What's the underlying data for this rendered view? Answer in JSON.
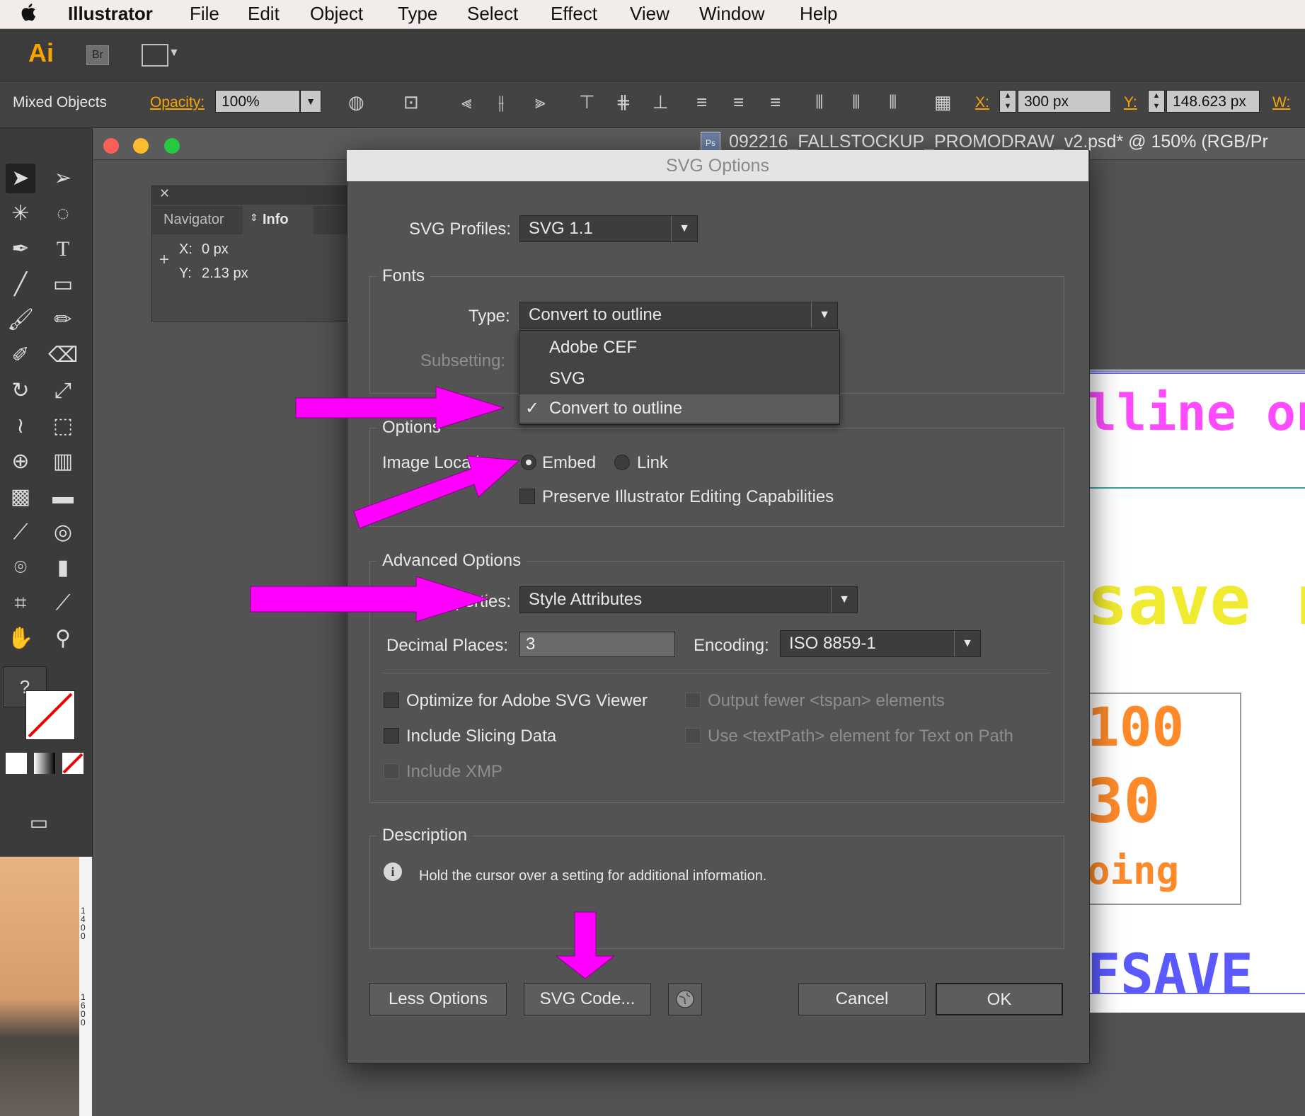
{
  "menubar": {
    "apple": "",
    "items": [
      "Illustrator",
      "File",
      "Edit",
      "Object",
      "Type",
      "Select",
      "Effect",
      "View",
      "Window",
      "Help"
    ]
  },
  "appbar": {
    "logo": "Ai",
    "bridge": "Br"
  },
  "control_bar": {
    "selection": "Mixed Objects",
    "opacity_label": "Opacity:",
    "opacity_value": "100%",
    "x_label": "X:",
    "x_value": "300 px",
    "y_label": "Y:",
    "y_value": "148.623 px",
    "w_label": "W:"
  },
  "document": {
    "title": "092216_FALLSTOCKUP_PROMODRAW_v2.psd* @ 150% (RGB/Pr",
    "ps_badge": "Ps"
  },
  "info_panel": {
    "tab_navigator": "Navigator",
    "tab_info": "Info",
    "x_label": "X:",
    "x_value": "0 px",
    "y_label": "Y:",
    "y_value": "2.13 px"
  },
  "artboard_text": {
    "line1": "lline on",
    "line2": "save r",
    "line3": "100",
    "line4": "30",
    "line5": "oing",
    "line6": "FSAVE"
  },
  "ruler": {
    "mark1": "1400",
    "mark2": "1600"
  },
  "dialog": {
    "title": "SVG Options",
    "svg_profiles_label": "SVG Profiles:",
    "svg_profiles_value": "SVG 1.1",
    "fonts_group": "Fonts",
    "type_label": "Type:",
    "type_value": "Convert to outline",
    "subsetting_label": "Subsetting:",
    "type_options": [
      "Adobe CEF",
      "SVG",
      "Convert to outline"
    ],
    "type_checkmark": "✓",
    "options_group": "Options",
    "image_location_label": "Image Location:",
    "embed_label": "Embed",
    "link_label": "Link",
    "preserve_label": "Preserve Illustrator Editing Capabilities",
    "advanced_group": "Advanced Options",
    "css_label": "CSS Properties:",
    "css_value": "Style Attributes",
    "decimal_label": "Decimal Places:",
    "decimal_value": "3",
    "encoding_label": "Encoding:",
    "encoding_value": "ISO 8859-1",
    "optimize_label": "Optimize for Adobe SVG Viewer",
    "slicing_label": "Include Slicing Data",
    "xmp_label": "Include XMP",
    "tspan_label": "Output fewer <tspan> elements",
    "textpath_label": "Use <textPath> element for Text on Path",
    "description_group": "Description",
    "description_text": "Hold the cursor over a setting for additional information.",
    "less_options": "Less Options",
    "svg_code": "SVG Code...",
    "cancel": "Cancel",
    "ok": "OK"
  },
  "colors": {
    "annotation_arrow": "#ff00ff",
    "dialog_bg": "#535353",
    "app_accent": "#f7a600"
  }
}
